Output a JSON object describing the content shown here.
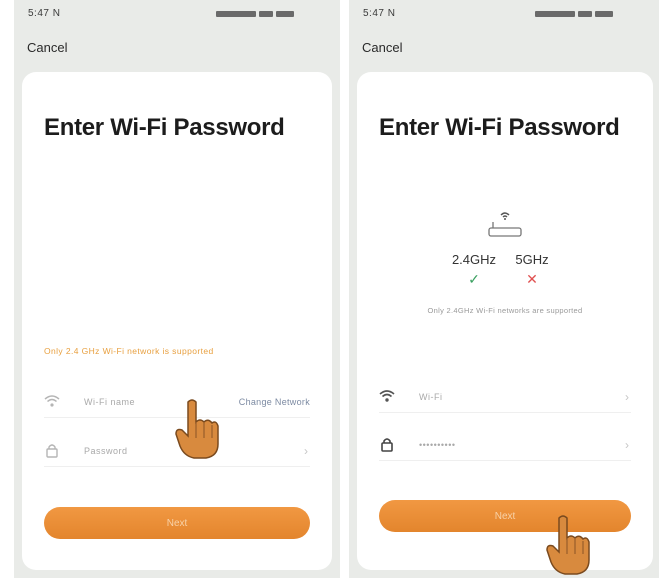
{
  "left_screen": {
    "status_time": "5:47 N",
    "cancel_label": "Cancel",
    "title": "Enter Wi-Fi Password",
    "warning": "Only 2.4 GHz Wi-Fi network is supported",
    "wifi_field": {
      "value": "Wi-Fi name",
      "link": "Change Network"
    },
    "password_field": {
      "value": "Password"
    },
    "next_label": "Next"
  },
  "right_screen": {
    "status_time": "5:47 N",
    "cancel_label": "Cancel",
    "title": "Enter Wi-Fi Password",
    "band_24": "2.4GHz",
    "band_5": "5GHz",
    "band_24_mark": "✓",
    "band_5_mark": "✕",
    "band_note": "Only 2.4GHz Wi-Fi networks are supported",
    "wifi_field": {
      "value": "Wi-Fi"
    },
    "password_field": {
      "value": "••••••••••"
    },
    "next_label": "Next"
  },
  "colors": {
    "accent": "#e98c35",
    "warning": "#e8a040",
    "check": "#3aa060",
    "cross": "#e05050"
  },
  "icons": [
    "wifi-icon",
    "lock-icon",
    "chevron-right-icon",
    "router-icon",
    "pointing-hand-icon"
  ]
}
